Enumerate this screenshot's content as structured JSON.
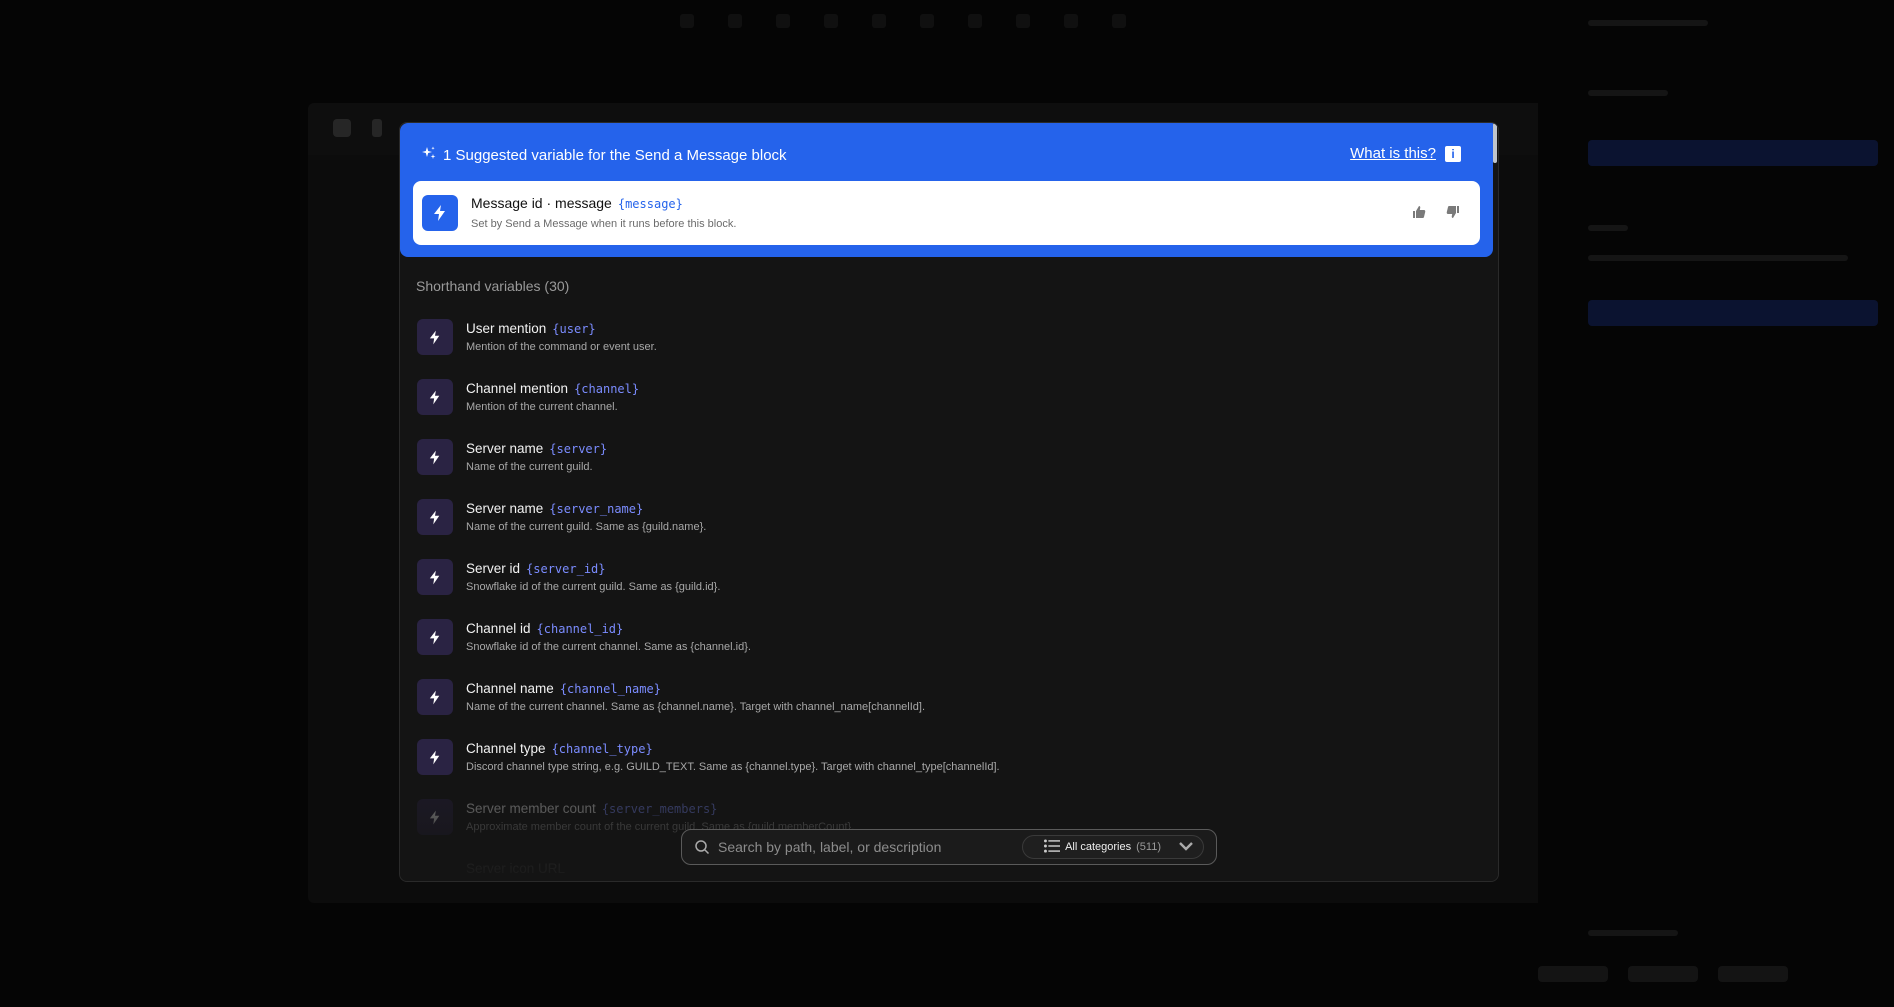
{
  "suggestion": {
    "heading": "1 Suggested variable for the Send a Message block",
    "help_link": "What is this?",
    "item": {
      "title": "Message id · message",
      "token": "{message}",
      "description": "Set by Send a Message when it runs before this block."
    }
  },
  "shorthand": {
    "title": "Shorthand variables (30)",
    "items": [
      {
        "title": "User mention",
        "token": "{user}",
        "description": "Mention of the command or event user."
      },
      {
        "title": "Channel mention",
        "token": "{channel}",
        "description": "Mention of the current channel."
      },
      {
        "title": "Server name",
        "token": "{server}",
        "description": "Name of the current guild."
      },
      {
        "title": "Server name",
        "token": "{server_name}",
        "description": "Name of the current guild. Same as {guild.name}."
      },
      {
        "title": "Server id",
        "token": "{server_id}",
        "description": "Snowflake id of the current guild. Same as {guild.id}."
      },
      {
        "title": "Channel id",
        "token": "{channel_id}",
        "description": "Snowflake id of the current channel. Same as {channel.id}."
      },
      {
        "title": "Channel name",
        "token": "{channel_name}",
        "description": "Name of the current channel. Same as {channel.name}. Target with channel_name[channelId]."
      },
      {
        "title": "Channel type",
        "token": "{channel_type}",
        "description": "Discord channel type string, e.g. GUILD_TEXT. Same as {channel.type}. Target with channel_type[channelId]."
      },
      {
        "title": "Server member count",
        "token": "{server_members}",
        "description": "Approximate member count of the current guild. Same as {guild.memberCount}."
      },
      {
        "title": "Server icon URL",
        "token": "",
        "description": ""
      }
    ]
  },
  "search": {
    "placeholder": "Search by path, label, or description",
    "category_label": "All categories",
    "category_count": "(511)"
  },
  "colors": {
    "accent": "#2563eb",
    "token": "#7b8cff",
    "icon_bg": "#2a2343"
  }
}
